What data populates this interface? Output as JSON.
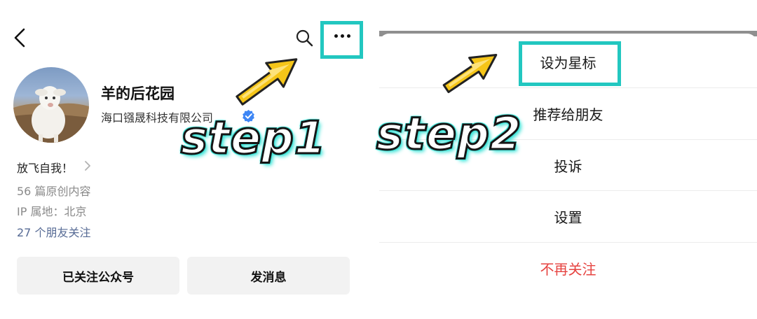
{
  "left_panel": {
    "account_name": "羊的后花园",
    "company_name": "海口镪晟科技有限公司",
    "signature": "放飞自我！",
    "articles": "56 篇原创内容",
    "ip_location": "IP 属地：北京",
    "friends_follow": "27 个朋友关注",
    "followed_button": "已关注公众号",
    "message_button": "发消息"
  },
  "right_panel": {
    "menu": [
      {
        "label": "设为星标"
      },
      {
        "label": "推荐给朋友"
      },
      {
        "label": "投诉"
      },
      {
        "label": "设置"
      },
      {
        "label": "不再关注"
      }
    ]
  },
  "annotations": {
    "step1": "step1",
    "step2": "step2",
    "highlight_color": "#22c7c0",
    "arrow_color": "#f5c518"
  },
  "colors": {
    "link": "#576b95",
    "danger": "#e64340",
    "verified": "#3d86f5"
  }
}
